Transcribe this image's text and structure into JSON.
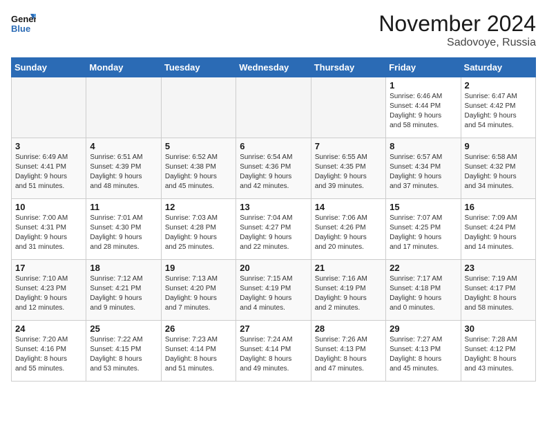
{
  "logo": {
    "line1": "General",
    "line2": "Blue"
  },
  "title": "November 2024",
  "subtitle": "Sadovoye, Russia",
  "days_header": [
    "Sunday",
    "Monday",
    "Tuesday",
    "Wednesday",
    "Thursday",
    "Friday",
    "Saturday"
  ],
  "weeks": [
    [
      {
        "num": "",
        "info": ""
      },
      {
        "num": "",
        "info": ""
      },
      {
        "num": "",
        "info": ""
      },
      {
        "num": "",
        "info": ""
      },
      {
        "num": "",
        "info": ""
      },
      {
        "num": "1",
        "info": "Sunrise: 6:46 AM\nSunset: 4:44 PM\nDaylight: 9 hours\nand 58 minutes."
      },
      {
        "num": "2",
        "info": "Sunrise: 6:47 AM\nSunset: 4:42 PM\nDaylight: 9 hours\nand 54 minutes."
      }
    ],
    [
      {
        "num": "3",
        "info": "Sunrise: 6:49 AM\nSunset: 4:41 PM\nDaylight: 9 hours\nand 51 minutes."
      },
      {
        "num": "4",
        "info": "Sunrise: 6:51 AM\nSunset: 4:39 PM\nDaylight: 9 hours\nand 48 minutes."
      },
      {
        "num": "5",
        "info": "Sunrise: 6:52 AM\nSunset: 4:38 PM\nDaylight: 9 hours\nand 45 minutes."
      },
      {
        "num": "6",
        "info": "Sunrise: 6:54 AM\nSunset: 4:36 PM\nDaylight: 9 hours\nand 42 minutes."
      },
      {
        "num": "7",
        "info": "Sunrise: 6:55 AM\nSunset: 4:35 PM\nDaylight: 9 hours\nand 39 minutes."
      },
      {
        "num": "8",
        "info": "Sunrise: 6:57 AM\nSunset: 4:34 PM\nDaylight: 9 hours\nand 37 minutes."
      },
      {
        "num": "9",
        "info": "Sunrise: 6:58 AM\nSunset: 4:32 PM\nDaylight: 9 hours\nand 34 minutes."
      }
    ],
    [
      {
        "num": "10",
        "info": "Sunrise: 7:00 AM\nSunset: 4:31 PM\nDaylight: 9 hours\nand 31 minutes."
      },
      {
        "num": "11",
        "info": "Sunrise: 7:01 AM\nSunset: 4:30 PM\nDaylight: 9 hours\nand 28 minutes."
      },
      {
        "num": "12",
        "info": "Sunrise: 7:03 AM\nSunset: 4:28 PM\nDaylight: 9 hours\nand 25 minutes."
      },
      {
        "num": "13",
        "info": "Sunrise: 7:04 AM\nSunset: 4:27 PM\nDaylight: 9 hours\nand 22 minutes."
      },
      {
        "num": "14",
        "info": "Sunrise: 7:06 AM\nSunset: 4:26 PM\nDaylight: 9 hours\nand 20 minutes."
      },
      {
        "num": "15",
        "info": "Sunrise: 7:07 AM\nSunset: 4:25 PM\nDaylight: 9 hours\nand 17 minutes."
      },
      {
        "num": "16",
        "info": "Sunrise: 7:09 AM\nSunset: 4:24 PM\nDaylight: 9 hours\nand 14 minutes."
      }
    ],
    [
      {
        "num": "17",
        "info": "Sunrise: 7:10 AM\nSunset: 4:23 PM\nDaylight: 9 hours\nand 12 minutes."
      },
      {
        "num": "18",
        "info": "Sunrise: 7:12 AM\nSunset: 4:21 PM\nDaylight: 9 hours\nand 9 minutes."
      },
      {
        "num": "19",
        "info": "Sunrise: 7:13 AM\nSunset: 4:20 PM\nDaylight: 9 hours\nand 7 minutes."
      },
      {
        "num": "20",
        "info": "Sunrise: 7:15 AM\nSunset: 4:19 PM\nDaylight: 9 hours\nand 4 minutes."
      },
      {
        "num": "21",
        "info": "Sunrise: 7:16 AM\nSunset: 4:19 PM\nDaylight: 9 hours\nand 2 minutes."
      },
      {
        "num": "22",
        "info": "Sunrise: 7:17 AM\nSunset: 4:18 PM\nDaylight: 9 hours\nand 0 minutes."
      },
      {
        "num": "23",
        "info": "Sunrise: 7:19 AM\nSunset: 4:17 PM\nDaylight: 8 hours\nand 58 minutes."
      }
    ],
    [
      {
        "num": "24",
        "info": "Sunrise: 7:20 AM\nSunset: 4:16 PM\nDaylight: 8 hours\nand 55 minutes."
      },
      {
        "num": "25",
        "info": "Sunrise: 7:22 AM\nSunset: 4:15 PM\nDaylight: 8 hours\nand 53 minutes."
      },
      {
        "num": "26",
        "info": "Sunrise: 7:23 AM\nSunset: 4:14 PM\nDaylight: 8 hours\nand 51 minutes."
      },
      {
        "num": "27",
        "info": "Sunrise: 7:24 AM\nSunset: 4:14 PM\nDaylight: 8 hours\nand 49 minutes."
      },
      {
        "num": "28",
        "info": "Sunrise: 7:26 AM\nSunset: 4:13 PM\nDaylight: 8 hours\nand 47 minutes."
      },
      {
        "num": "29",
        "info": "Sunrise: 7:27 AM\nSunset: 4:13 PM\nDaylight: 8 hours\nand 45 minutes."
      },
      {
        "num": "30",
        "info": "Sunrise: 7:28 AM\nSunset: 4:12 PM\nDaylight: 8 hours\nand 43 minutes."
      }
    ]
  ]
}
